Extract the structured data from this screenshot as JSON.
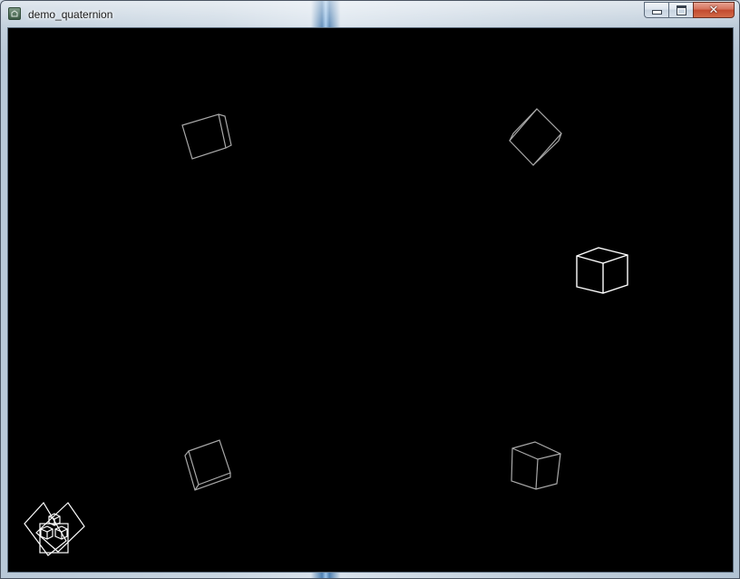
{
  "window": {
    "title": "demo_quaternion",
    "close_glyph": "✕"
  },
  "icons": {
    "app": "app-icon",
    "minimize": "minimize-icon",
    "maximize": "maximize-icon",
    "close": "close-icon"
  },
  "colors": {
    "canvas_background": "#000000",
    "cube_bright": "#ffffff",
    "cube_dim": "#a8a8a8",
    "close_button": "#c24a2f"
  },
  "scene": {
    "cube_count": 5,
    "has_axis_gizmo": true
  }
}
